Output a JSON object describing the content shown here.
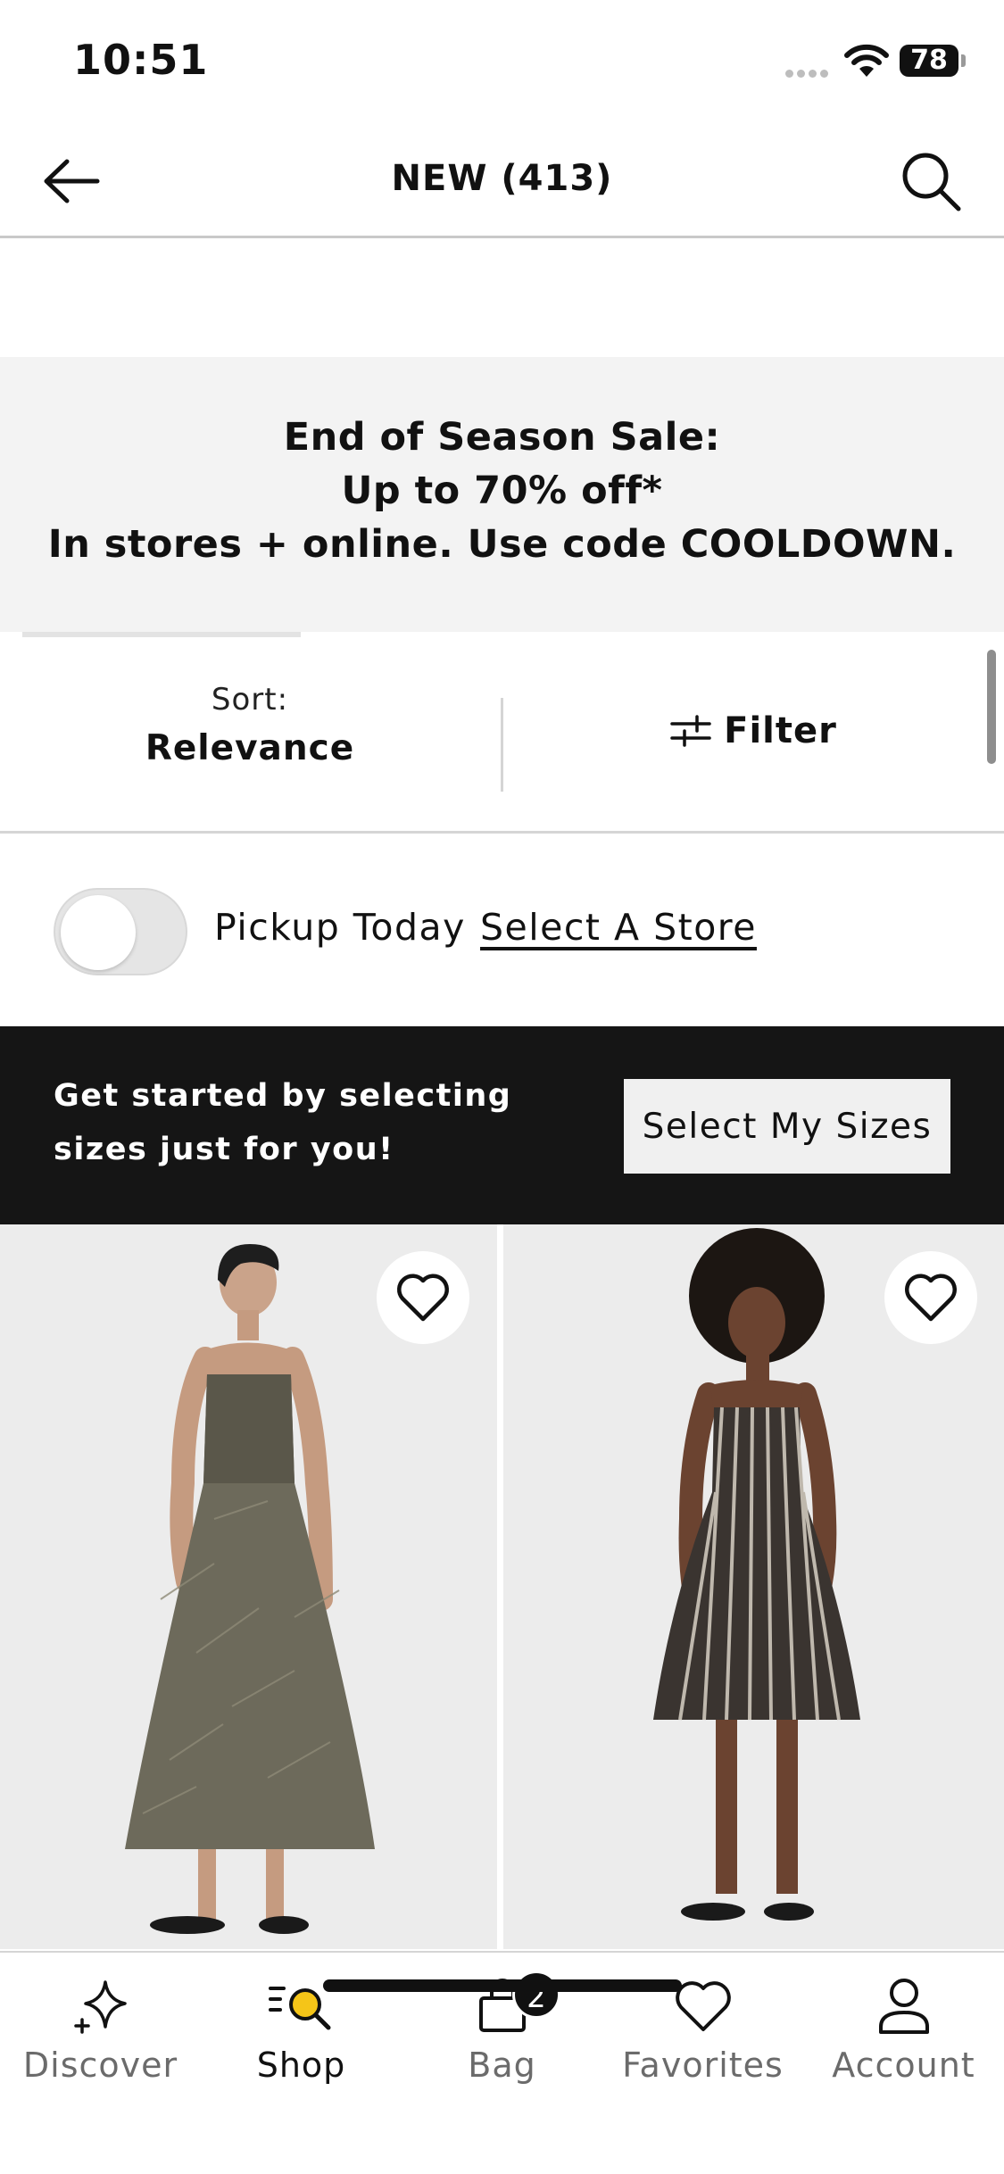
{
  "status_bar": {
    "time": "10:51",
    "battery": "78"
  },
  "header": {
    "title": "NEW (413)"
  },
  "promo": {
    "line1": "End of Season Sale:",
    "line2": "Up to 70% off*",
    "line3": "In stores + online. Use code COOLDOWN."
  },
  "sort": {
    "label": "Sort:",
    "value": "Relevance"
  },
  "filter": {
    "label": "Filter"
  },
  "pickup": {
    "label": "Pickup Today",
    "link": "Select A Store",
    "toggle_on": false
  },
  "sizes_banner": {
    "text": "Get started by selecting sizes just for you!",
    "button": "Select My Sizes"
  },
  "products": [
    {
      "icon": "heart-icon",
      "favorited": false
    },
    {
      "icon": "heart-icon",
      "favorited": false
    }
  ],
  "tabbar": {
    "tabs": [
      {
        "label": "Discover",
        "icon": "sparkle-icon",
        "active": false
      },
      {
        "label": "Shop",
        "icon": "shop-search-icon",
        "active": true
      },
      {
        "label": "Bag",
        "icon": "bag-icon",
        "active": false,
        "badge": "2"
      },
      {
        "label": "Favorites",
        "icon": "heart-icon",
        "active": false
      },
      {
        "label": "Account",
        "icon": "person-icon",
        "active": false
      }
    ]
  },
  "colors": {
    "accent": "#F5C518",
    "dark_banner": "#151515",
    "promo_bg": "#F3F3F3"
  }
}
